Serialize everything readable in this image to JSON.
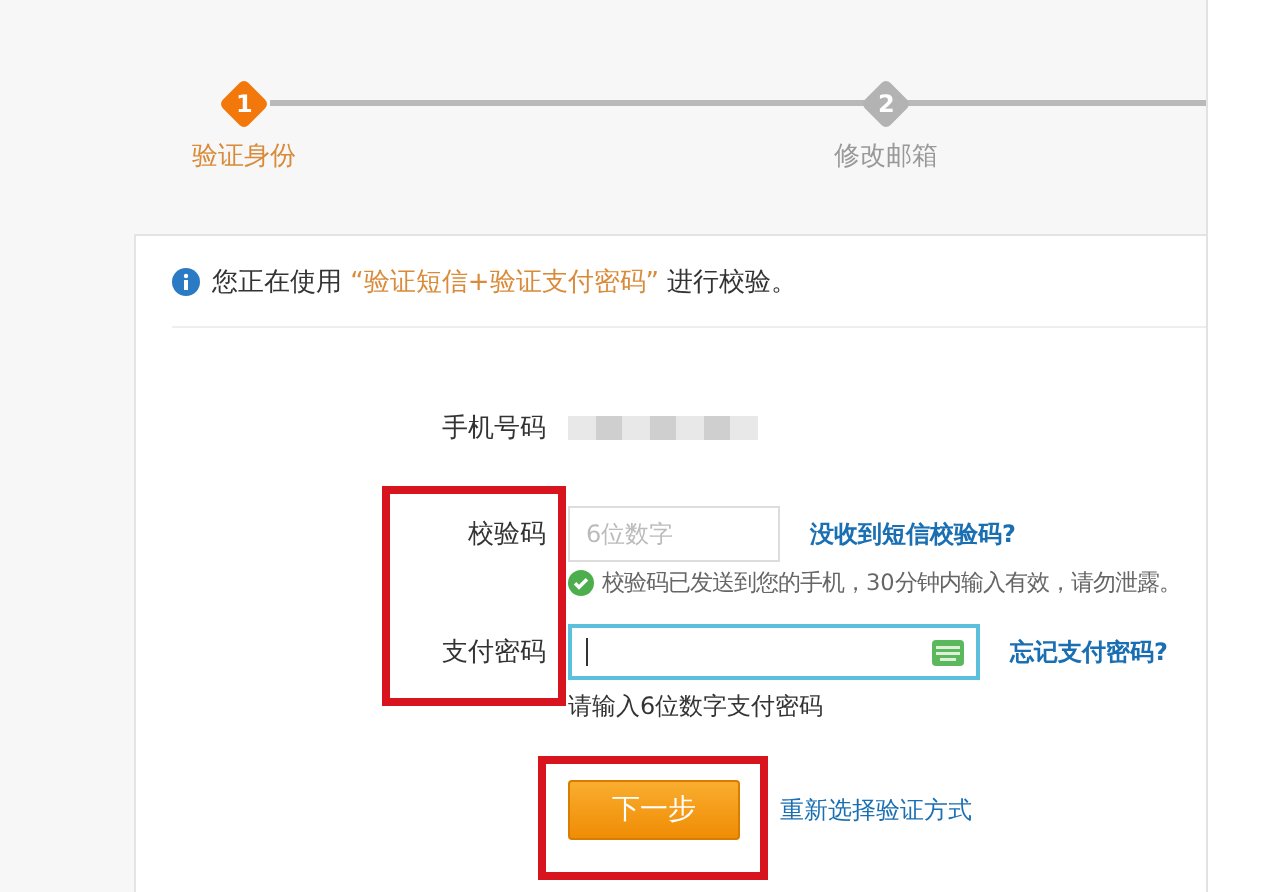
{
  "steps": [
    {
      "number": "1",
      "label": "验证身份",
      "selected": true
    },
    {
      "number": "2",
      "label": "修改邮箱",
      "selected": false
    }
  ],
  "notice": {
    "prefix": "您正在使用",
    "method": "“验证短信+验证支付密码”",
    "suffix": "进行校验。"
  },
  "phone": {
    "label": "手机号码"
  },
  "fields": [
    {
      "kind": "code",
      "label": "校验码",
      "placeholder": "6位数字",
      "link": "没收到短信校验码?",
      "hint": "校验码已发送到您的手机，30分钟内输入有效，请勿泄露。",
      "focused": false
    },
    {
      "kind": "password",
      "label": "支付密码",
      "link": "忘记支付密码?",
      "hint": "请输入6位数字支付密码",
      "focused": true
    }
  ],
  "actions": {
    "submit": "下一步",
    "alt_link": "重新选择验证方式"
  }
}
